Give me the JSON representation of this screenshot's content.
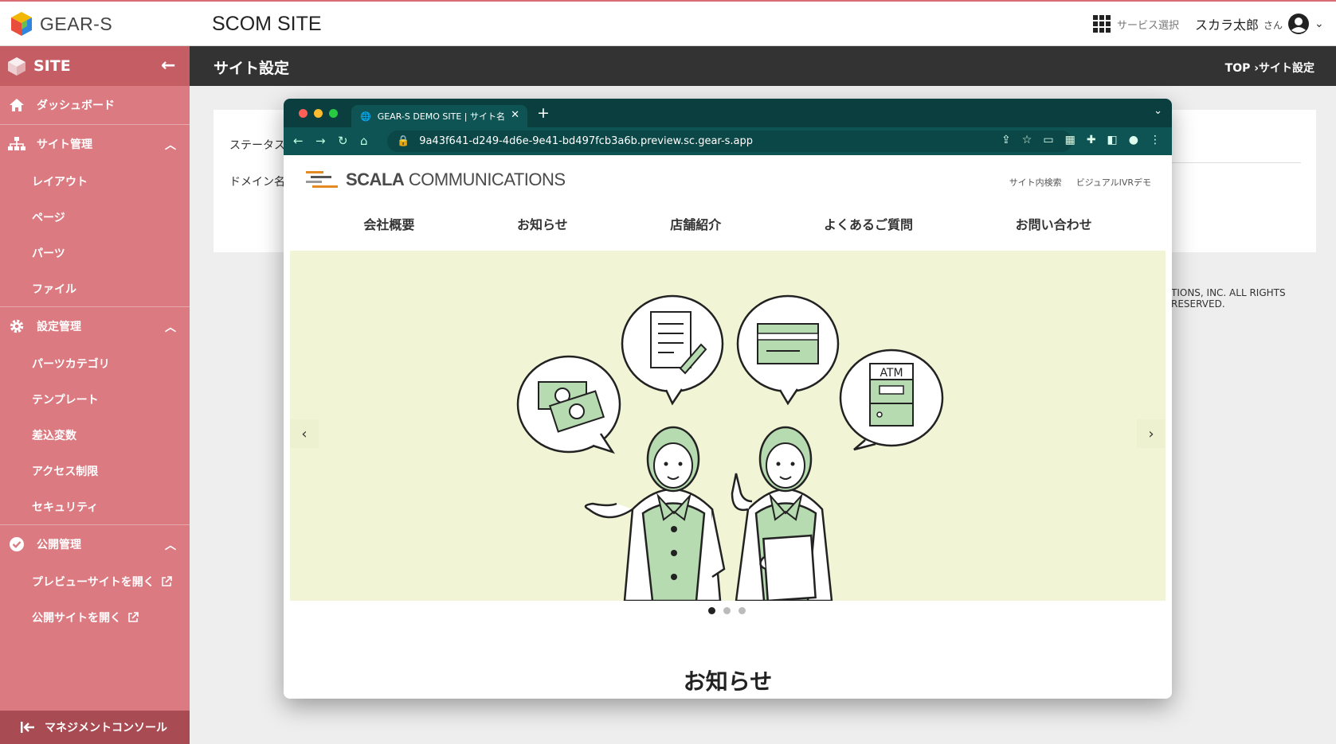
{
  "header": {
    "logo_text": "GEAR-S",
    "site_name": "SCOM SITE",
    "service_select": "サービス選択",
    "user_name": "スカラ太郎",
    "user_suffix": "さん"
  },
  "sidebar": {
    "title": "SITE",
    "dashboard": "ダッシュボード",
    "site_mgmt": {
      "label": "サイト管理",
      "items": [
        "レイアウト",
        "ページ",
        "パーツ",
        "ファイル"
      ]
    },
    "settings_mgmt": {
      "label": "設定管理",
      "items": [
        "パーツカテゴリ",
        "テンプレート",
        "差込変数",
        "アクセス制限",
        "セキュリティ"
      ]
    },
    "publish_mgmt": {
      "label": "公開管理",
      "items": [
        "プレビューサイトを開く",
        "公開サイトを開く"
      ]
    },
    "footer": "マネジメントコンソール"
  },
  "page": {
    "title": "サイト設定",
    "breadcrumb": "TOP ›サイト設定",
    "status_label": "ステータス",
    "domain_label": "ドメイン名",
    "copyright": "TIONS, INC. ALL RIGHTS RESERVED."
  },
  "browser": {
    "tab_title": "GEAR-S DEMO SITE | サイト名",
    "url": "9a43f641-d249-4d6e-9e41-bd497fcb3a6b.preview.sc.gear-s.app",
    "dot_colors": [
      "#ff5f57",
      "#febc2e",
      "#28c840"
    ]
  },
  "preview_site": {
    "brand_bold": "SCALA",
    "brand_rest": " COMMUNICATIONS",
    "links": [
      "サイト内検索",
      "ビジュアルIVRデモ"
    ],
    "menu": [
      "会社概要",
      "お知らせ",
      "店舗紹介",
      "よくあるご質問",
      "お問い合わせ"
    ],
    "hero_atm_text": "ATM",
    "slides_total": 3,
    "slide_active": 1,
    "section_title": "お知らせ"
  }
}
